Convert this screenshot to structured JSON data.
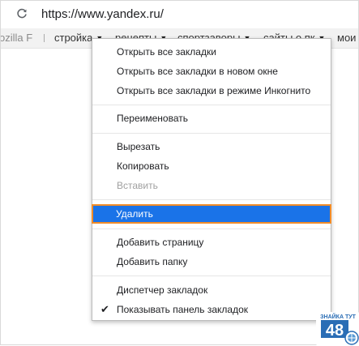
{
  "omnibox": {
    "url": "https://www.yandex.ru/",
    "reload_icon": "reload-icon"
  },
  "bookmarks_bar": {
    "items": [
      {
        "label": "ozilla F"
      },
      {
        "label": "стройка"
      },
      {
        "label": "рецепты"
      },
      {
        "label": "спортзаворы"
      },
      {
        "label": "сайты о пк"
      },
      {
        "label": "мои"
      }
    ]
  },
  "context_menu": {
    "groups": [
      {
        "items": [
          {
            "label": "Открыть все закладки"
          },
          {
            "label": "Открыть все закладки в новом окне"
          },
          {
            "label": "Открыть все закладки в режиме Инкогнито"
          }
        ]
      },
      {
        "items": [
          {
            "label": "Переименовать"
          }
        ]
      },
      {
        "items": [
          {
            "label": "Вырезать"
          },
          {
            "label": "Копировать"
          },
          {
            "label": "Вставить",
            "disabled": true
          }
        ]
      },
      {
        "items": [
          {
            "label": "Удалить",
            "highlighted": true
          }
        ]
      },
      {
        "items": [
          {
            "label": "Добавить страницу"
          },
          {
            "label": "Добавить папку"
          }
        ]
      },
      {
        "items": [
          {
            "label": "Диспетчер закладок"
          },
          {
            "label": "Показывать панель закладок",
            "checked": true
          }
        ]
      }
    ]
  },
  "watermark": {
    "text_top": "ЗНАЙКА ТУТ",
    "number": "48"
  },
  "colors": {
    "highlight_bg": "#1a73e8",
    "highlight_border": "#f28c28",
    "disabled_text": "#a0a0a0",
    "logo_blue": "#2a6db5"
  }
}
